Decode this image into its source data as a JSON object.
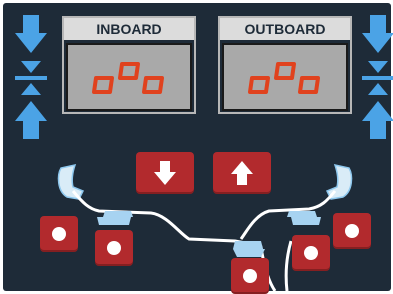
{
  "labels": {
    "inboard": "INBOARD",
    "outboard": "OUTBOARD"
  },
  "displays": {
    "inboard_symbol": "ooo",
    "outboard_symbol": "ooo"
  },
  "colors": {
    "background": "#1e2b38",
    "accent_blue": "#4ba3e6",
    "button_red": "#b22a2d",
    "display_grey": "#a9a9a9",
    "segment_red": "#e0421e"
  },
  "icons": {
    "left_down": "arrow-down-icon",
    "left_center": "center-collapse-icon",
    "left_up": "arrow-up-icon",
    "right_down": "arrow-down-icon",
    "right_center": "center-collapse-icon",
    "right_up": "arrow-up-icon",
    "center_down": "arrow-down-icon",
    "center_up": "arrow-up-icon"
  }
}
